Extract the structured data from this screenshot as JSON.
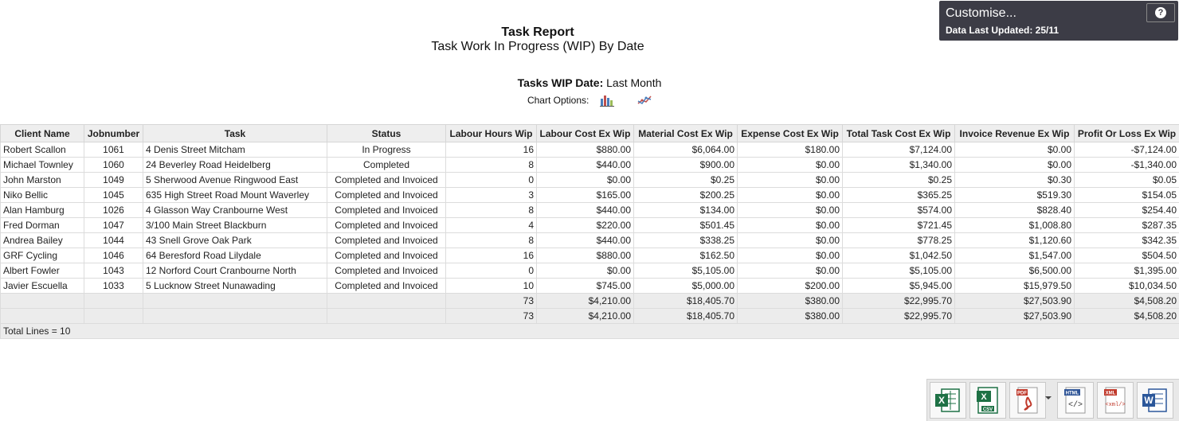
{
  "report": {
    "title": "Task Report",
    "subtitle": "Task Work In Progress (WIP) By Date",
    "wip_date_label": "Tasks WIP Date:",
    "wip_date_value": "Last Month",
    "chart_options_label": "Chart Options:",
    "chart_icons": [
      "bar-chart-icon",
      "line-chart-icon"
    ]
  },
  "customise": {
    "label": "Customise...",
    "updated": "Data Last Updated: 25/11",
    "help_glyph": "?"
  },
  "table": {
    "columns": [
      "Client Name",
      "Jobnumber",
      "Task",
      "Status",
      "Labour Hours Wip",
      "Labour Cost Ex Wip",
      "Material Cost Ex Wip",
      "Expense Cost Ex Wip",
      "Total Task Cost Ex Wip",
      "Invoice Revenue Ex Wip",
      "Profit Or Loss Ex Wip"
    ],
    "rows": [
      [
        "Robert Scallon",
        "1061",
        "4 Denis Street Mitcham",
        "In Progress",
        "16",
        "$880.00",
        "$6,064.00",
        "$180.00",
        "$7,124.00",
        "$0.00",
        "-$7,124.00"
      ],
      [
        "Michael Townley",
        "1060",
        "24 Beverley Road Heidelberg",
        "Completed",
        "8",
        "$440.00",
        "$900.00",
        "$0.00",
        "$1,340.00",
        "$0.00",
        "-$1,340.00"
      ],
      [
        "John Marston",
        "1049",
        "5 Sherwood Avenue Ringwood East",
        "Completed and Invoiced",
        "0",
        "$0.00",
        "$0.25",
        "$0.00",
        "$0.25",
        "$0.30",
        "$0.05"
      ],
      [
        "Niko Bellic",
        "1045",
        "635 High Street Road Mount Waverley",
        "Completed and Invoiced",
        "3",
        "$165.00",
        "$200.25",
        "$0.00",
        "$365.25",
        "$519.30",
        "$154.05"
      ],
      [
        "Alan Hamburg",
        "1026",
        "4 Glasson Way Cranbourne West",
        "Completed and Invoiced",
        "8",
        "$440.00",
        "$134.00",
        "$0.00",
        "$574.00",
        "$828.40",
        "$254.40"
      ],
      [
        "Fred Dorman",
        "1047",
        "3/100 Main Street Blackburn",
        "Completed and Invoiced",
        "4",
        "$220.00",
        "$501.45",
        "$0.00",
        "$721.45",
        "$1,008.80",
        "$287.35"
      ],
      [
        "Andrea Bailey",
        "1044",
        "43 Snell Grove Oak Park",
        "Completed and Invoiced",
        "8",
        "$440.00",
        "$338.25",
        "$0.00",
        "$778.25",
        "$1,120.60",
        "$342.35"
      ],
      [
        "GRF Cycling",
        "1046",
        "64 Beresford Road Lilydale",
        "Completed and Invoiced",
        "16",
        "$880.00",
        "$162.50",
        "$0.00",
        "$1,042.50",
        "$1,547.00",
        "$504.50"
      ],
      [
        "Albert Fowler",
        "1043",
        "12 Norford Court Cranbourne North",
        "Completed and Invoiced",
        "0",
        "$0.00",
        "$5,105.00",
        "$0.00",
        "$5,105.00",
        "$6,500.00",
        "$1,395.00"
      ],
      [
        "Javier Escuella",
        "1033",
        "5 Lucknow Street Nunawading",
        "Completed and Invoiced",
        "10",
        "$745.00",
        "$5,000.00",
        "$200.00",
        "$5,945.00",
        "$15,979.50",
        "$10,034.50"
      ]
    ],
    "totals": [
      [
        "",
        "",
        "",
        "",
        "73",
        "$4,210.00",
        "$18,405.70",
        "$380.00",
        "$22,995.70",
        "$27,503.90",
        "$4,508.20"
      ],
      [
        "",
        "",
        "",
        "",
        "73",
        "$4,210.00",
        "$18,405.70",
        "$380.00",
        "$22,995.70",
        "$27,503.90",
        "$4,508.20"
      ]
    ],
    "footer": "Total Lines = 10"
  },
  "exports": [
    {
      "icon": "excel-export-icon",
      "color": "#1e7145"
    },
    {
      "icon": "csv-export-icon",
      "color": "#1e7145",
      "text": "CSV"
    },
    {
      "icon": "pdf-export-icon",
      "color": "#c0392b",
      "text": "PDF"
    },
    {
      "icon": "html-export-icon",
      "color": "#2f5597",
      "text": "HTML"
    },
    {
      "icon": "xml-export-icon",
      "color": "#c0392b",
      "text": "XML"
    },
    {
      "icon": "word-export-icon",
      "color": "#2b579a"
    }
  ]
}
